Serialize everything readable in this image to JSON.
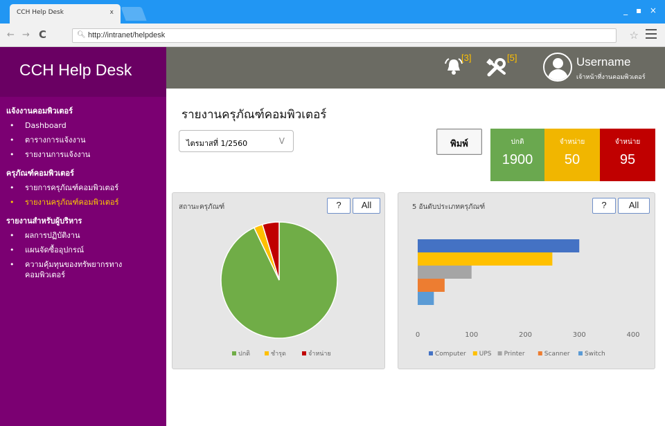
{
  "browser": {
    "tab_title": "CCH Help Desk",
    "tab_close": "x",
    "url": "http://intranet/helpdesk",
    "window_controls": "_ ▪ ×"
  },
  "sidebar": {
    "brand": "CCH Help Desk",
    "sections": [
      {
        "title": "แจ้งงานคอมพิวเตอร์",
        "items": [
          "Dashboard",
          "ตารางการแจ้งงาน",
          "รายงานการแจ้งงาน"
        ]
      },
      {
        "title": "ครุภัณฑ์คอมพิวเตอร์",
        "items": [
          "รายการครุภัณฑ์คอมพิวเตอร์",
          "รายงานครุภัณฑ์คอมพิวเตอร์"
        ]
      },
      {
        "title": "รายงานสำหรับผู้บริหาร",
        "items": [
          "ผลการปฏิบัติงาน",
          "แผนจัดซื้ออุปกรณ์",
          "ความคุ้มทุนของทรัพยากรทางคอมพิวเตอร์"
        ]
      }
    ],
    "active_item": "รายงานครุภัณฑ์คอมพิวเตอร์",
    "accent_color": "#7b0072"
  },
  "header": {
    "notifications_count": "[3]",
    "tools_count": "[5]",
    "username": "Username",
    "role": "เจ้าหน้าที่งานคอมพิวเตอร์"
  },
  "main": {
    "title": "รายงานครุภัณฑ์คอมพิวเตอร์",
    "period_select": "ไตรมาสที่ 1/2560",
    "print_label": "พิมพ์",
    "stats": [
      {
        "label": "ปกติ",
        "value": "1900",
        "color": "#6aa84f"
      },
      {
        "label": "จำหน่าย",
        "value": "50",
        "color": "#f1b600"
      },
      {
        "label": "จำหน่าย",
        "value": "95",
        "color": "#c00000"
      }
    ]
  },
  "panels": {
    "help_label": "?",
    "all_label": "All",
    "status_title": "สถานะครุภัณฑ์",
    "top5_title": "5 อันดับประเภทครุภัณฑ์"
  },
  "chart_data": [
    {
      "type": "pie",
      "title": "สถานะครุภัณฑ์",
      "categories": [
        "ปกติ",
        "ชำรุด",
        "จำหน่าย"
      ],
      "values": [
        1900,
        50,
        95
      ],
      "colors": [
        "#70ad47",
        "#ffc000",
        "#c00000"
      ],
      "legend": "bottom"
    },
    {
      "type": "bar",
      "orientation": "horizontal",
      "title": "5 อันดับประเภทครุภัณฑ์",
      "categories": [
        "Computer",
        "UPS",
        "Printer",
        "Scanner",
        "Switch"
      ],
      "values": [
        300,
        250,
        100,
        50,
        30
      ],
      "colors": [
        "#4472c4",
        "#ffc000",
        "#a5a5a5",
        "#ed7d31",
        "#5b9bd5"
      ],
      "xlim": [
        0,
        400
      ],
      "xticks": [
        0,
        100,
        200,
        300,
        400
      ],
      "legend": "bottom"
    }
  ]
}
